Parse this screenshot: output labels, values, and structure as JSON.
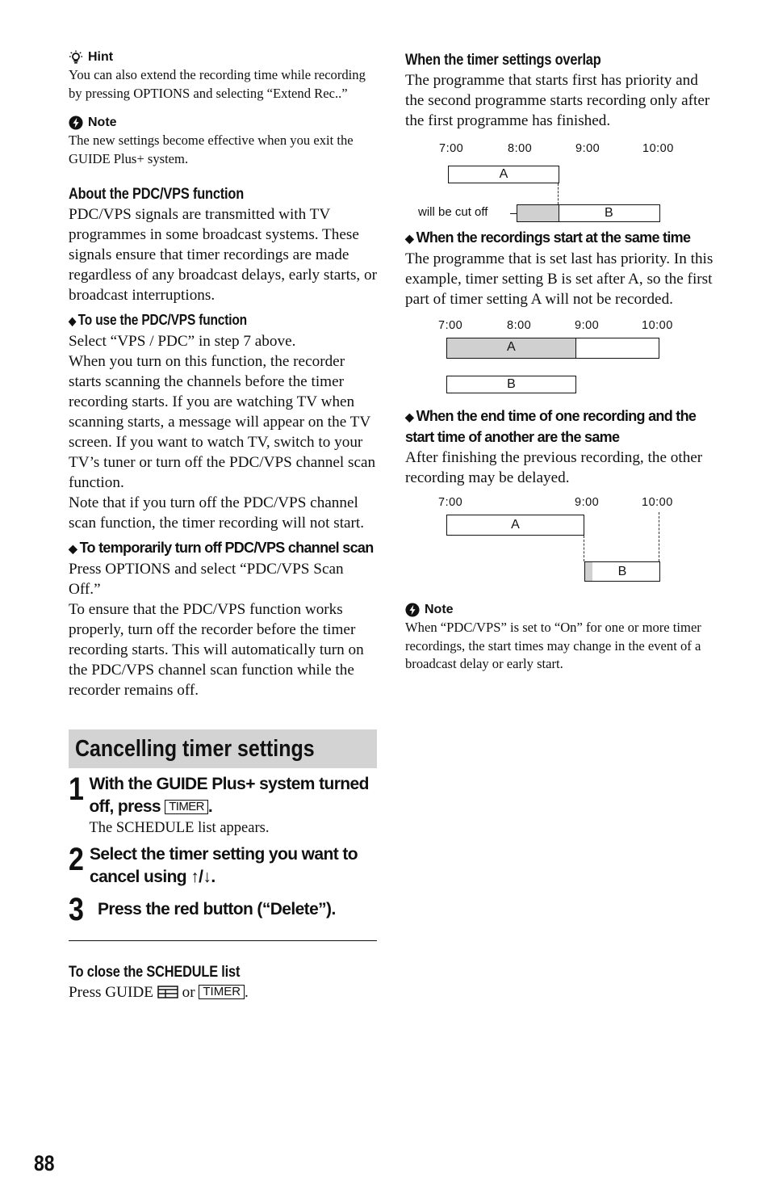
{
  "page_number": "88",
  "left": {
    "hint": {
      "title": "Hint",
      "icon": "lightbulb-icon",
      "text": "You can also extend the recording time while recording by pressing OPTIONS and selecting “Extend Rec..”"
    },
    "note1": {
      "title": "Note",
      "icon": "note-icon",
      "text": "The new settings become effective when you exit the GUIDE Plus+ system."
    },
    "about": {
      "heading": "About the PDC/VPS function",
      "text": "PDC/VPS signals are transmitted with TV programmes in some broadcast systems. These signals ensure that timer recordings are made regardless of any broadcast delays, early starts, or broadcast interruptions."
    },
    "use": {
      "heading": "To use the PDC/VPS function",
      "p1": "Select “VPS / PDC” in step 7 above.",
      "p2": "When you turn on this function, the recorder starts scanning the channels before the timer recording starts. If you are watching TV when scanning starts, a message will appear on the TV screen. If you want to watch TV, switch to your TV’s tuner or turn off the PDC/VPS channel scan function.",
      "p3": "Note that if you turn off the PDC/VPS channel scan function, the timer recording will not start."
    },
    "temp_off": {
      "heading": "To temporarily turn off PDC/VPS channel scan",
      "p1": "Press OPTIONS and select “PDC/VPS Scan Off.”",
      "p2": "To ensure that the PDC/VPS function works properly, turn off the recorder before the timer recording starts. This will automatically turn on the PDC/VPS channel scan function while the recorder remains off."
    },
    "cancel_section": {
      "title": "Cancelling timer settings",
      "steps": [
        {
          "num": "1",
          "text_a": "With the GUIDE Plus+ system turned off, press",
          "key": "TIMER",
          "text_b": ".",
          "sub": "The SCHEDULE list appears."
        },
        {
          "num": "2",
          "text_a": "Select the timer setting you want to cancel using",
          "arrows": "↑/↓",
          "text_b": "."
        },
        {
          "num": "3",
          "text_a": "Press the red button (“Delete”)."
        }
      ]
    },
    "close": {
      "heading": "To close the SCHEDULE list",
      "text_a": "Press GUIDE",
      "guide_icon": "guide-icon",
      "text_or": "or",
      "key": "TIMER",
      "text_end": "."
    }
  },
  "right": {
    "overlap": {
      "heading": "When the timer settings overlap",
      "text": "The programme that starts first has priority and the second programme starts recording only after the first programme has finished."
    },
    "diagram1": {
      "ticks": [
        "7:00",
        "8:00",
        "9:00",
        "10:00"
      ],
      "bar_a": {
        "label": "A",
        "start": "7:00",
        "end": "8:40"
      },
      "bar_b": {
        "label": "B",
        "start": "8:00",
        "end": "10:00",
        "cut_off_until": "8:40"
      },
      "cut_label": "will be cut off"
    },
    "same_start": {
      "heading": "When the recordings start at the same time",
      "text": "The programme that is set last has priority. In this example, timer setting B is set after A, so the first part of timer setting A will not be recorded."
    },
    "diagram2": {
      "ticks": [
        "7:00",
        "8:00",
        "9:00",
        "10:00"
      ],
      "bar_a": {
        "label": "A",
        "start": "7:00",
        "end": "10:00",
        "shaded_until": "8:55"
      },
      "bar_b": {
        "label": "B",
        "start": "7:00",
        "end": "8:55"
      }
    },
    "end_start": {
      "heading": "When the end time of one recording and the start time of another are the same",
      "text": "After finishing the previous recording, the other recording may be delayed."
    },
    "diagram3": {
      "ticks": [
        "7:00",
        "9:00",
        "10:00"
      ],
      "bar_a": {
        "label": "A",
        "start": "7:00",
        "end": "9:00"
      },
      "bar_b": {
        "label": "B",
        "start": "9:00",
        "end": "10:00",
        "delay": "short"
      }
    },
    "note2": {
      "title": "Note",
      "icon": "note-icon",
      "text": "When “PDC/VPS” is set to “On” for one or more timer recordings, the start times may change in the event of a broadcast delay or early start."
    }
  }
}
